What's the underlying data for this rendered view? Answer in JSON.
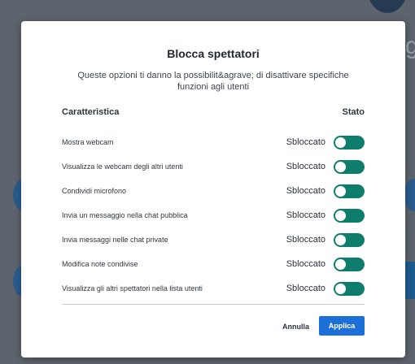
{
  "background": {
    "edge_letter": "g"
  },
  "modal": {
    "title": "Blocca spettatori",
    "description": "Queste opzioni ti danno la possibilit&agrave; di disattivare specifiche funzioni agli utenti",
    "column_feature": "Caratteristica",
    "column_status": "Stato",
    "rows": [
      {
        "label": "Mostra webcam",
        "status": "Sbloccato"
      },
      {
        "label": "Visualizza le webcam degli altri utenti",
        "status": "Sbloccato"
      },
      {
        "label": "Condividi microfono",
        "status": "Sbloccato"
      },
      {
        "label": "Invia un messaggio nella chat pubblica",
        "status": "Sbloccato"
      },
      {
        "label": "Invia messaggi nelle chat private",
        "status": "Sbloccato"
      },
      {
        "label": "Modifica note condivise",
        "status": "Sbloccato"
      },
      {
        "label": "Visualizza gli altri spettatori nella lista utenti",
        "status": "Sbloccato"
      }
    ],
    "cancel_label": "Annulla",
    "apply_label": "Applica"
  },
  "colors": {
    "toggle_on": "#0f7d6c",
    "apply_button": "#1d6fd8",
    "overlay": "#5d646d"
  }
}
